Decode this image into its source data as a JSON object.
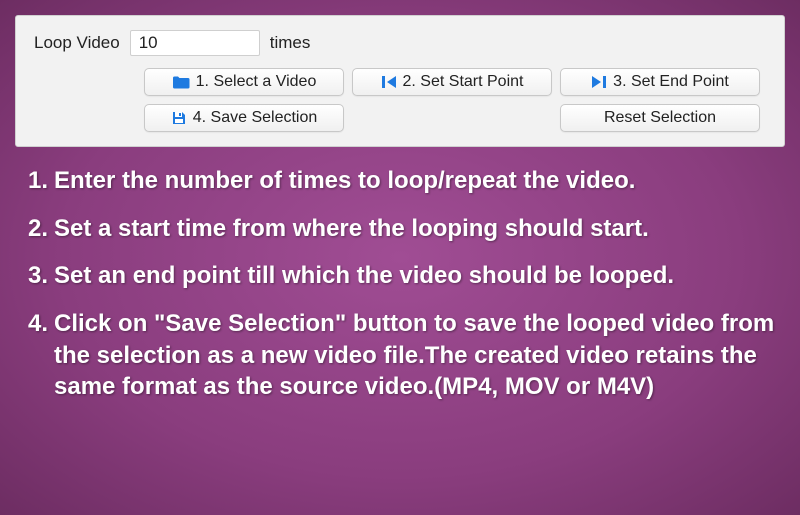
{
  "panel": {
    "loop_label": "Loop Video",
    "loop_value": "10",
    "times_label": "times",
    "buttons": {
      "select_video": "1. Select a Video",
      "set_start": "2. Set Start Point",
      "set_end": "3. Set End Point",
      "save_selection": "4. Save Selection",
      "reset_selection": "Reset Selection"
    }
  },
  "instructions": {
    "step1": {
      "num": "1.",
      "text": "Enter the number of times to loop/repeat the video."
    },
    "step2": {
      "num": "2.",
      "text": "Set a start time from where the looping should start."
    },
    "step3": {
      "num": "3.",
      "text": "Set an end point till which the video should be looped."
    },
    "step4": {
      "num": "4.",
      "text": "Click on \"Save Selection\" button to save the looped video from the selection as a new video file.The created video retains the same format as the source video.(MP4, MOV or M4V)"
    }
  },
  "colors": {
    "icon_blue": "#1e7ae0"
  }
}
